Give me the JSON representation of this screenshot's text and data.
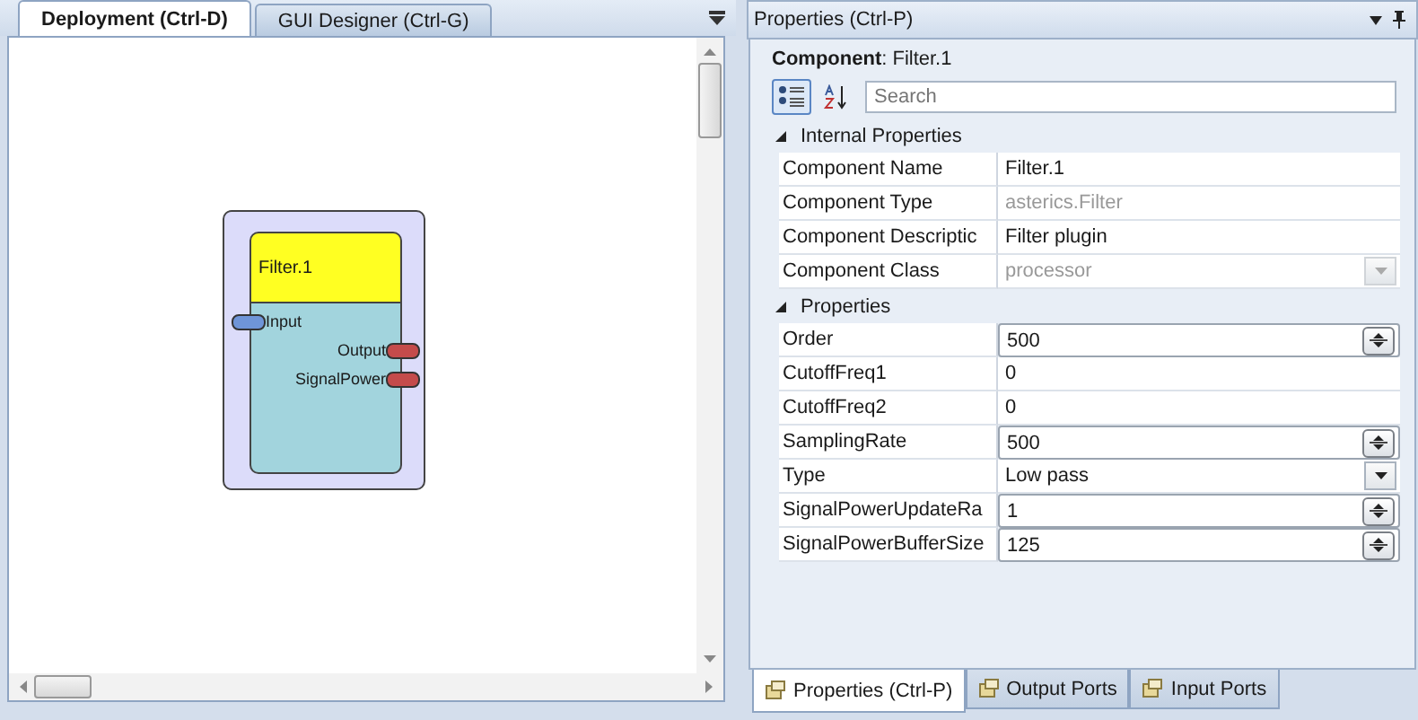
{
  "left_panel": {
    "tabs": [
      {
        "label": "Deployment (Ctrl-D)",
        "selected": true
      },
      {
        "label": "GUI Designer (Ctrl-G)",
        "selected": false
      }
    ],
    "component": {
      "name": "Filter.1",
      "input_ports": [
        "Input"
      ],
      "output_ports": [
        "Output",
        "SignalPower"
      ]
    }
  },
  "properties_panel": {
    "title": "Properties (Ctrl-P)",
    "component_heading": "**Component**: Filter.1",
    "toolbar": [
      {
        "kind": "categorized",
        "selected": true
      },
      {
        "kind": "alphabetical",
        "selected": false
      }
    ],
    "search": {
      "placeholder": "Search"
    },
    "sections": [
      {
        "title": "Internal Properties",
        "expanded": true,
        "rows": [
          {
            "name": "Component Name",
            "value": "Filter.1",
            "kind": "text",
            "disabled": false
          },
          {
            "name": "Component Type",
            "value": "asterics.Filter",
            "kind": "text",
            "disabled": true
          },
          {
            "name": "Component Descriptic",
            "value": "Filter plugin",
            "kind": "text",
            "disabled": false
          },
          {
            "name": "Component Class",
            "value": "processor",
            "kind": "dropdown",
            "disabled": true
          }
        ]
      },
      {
        "title": "Properties",
        "expanded": true,
        "rows": [
          {
            "name": "Order",
            "value": "500",
            "kind": "spinner",
            "disabled": false
          },
          {
            "name": "CutoffFreq1",
            "value": "0",
            "kind": "text",
            "disabled": false
          },
          {
            "name": "CutoffFreq2",
            "value": "0",
            "kind": "text",
            "disabled": false
          },
          {
            "name": "SamplingRate",
            "value": "500",
            "kind": "spinner",
            "disabled": false
          },
          {
            "name": "Type",
            "value": "Low pass",
            "kind": "dropdown",
            "disabled": false
          },
          {
            "name": "SignalPowerUpdateRa",
            "value": "1",
            "kind": "spinner",
            "disabled": false
          },
          {
            "name": "SignalPowerBufferSize",
            "value": "125",
            "kind": "spinner",
            "disabled": false
          }
        ]
      }
    ],
    "bottom_tabs": [
      {
        "label": "Properties (Ctrl-P)",
        "selected": true
      },
      {
        "label": "Output Ports",
        "selected": false
      },
      {
        "label": "Input Ports",
        "selected": false
      }
    ]
  }
}
